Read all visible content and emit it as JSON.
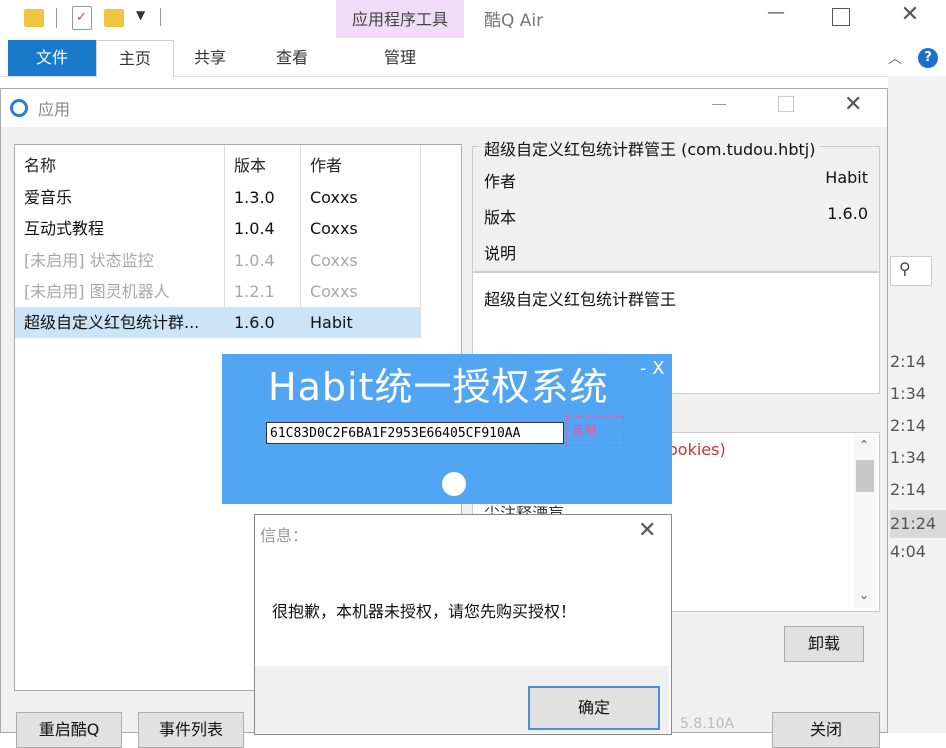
{
  "explorer": {
    "title": "酷Q Air",
    "contextual_tab": "应用程序工具",
    "tabs": [
      "文件",
      "主页",
      "共享",
      "查看",
      "管理"
    ],
    "help_glyph": "?",
    "times": [
      "2:14",
      "1:34",
      "2:14",
      "1:34",
      "2:14",
      "21:24",
      "4:04"
    ]
  },
  "dialog": {
    "title": "应用",
    "list": {
      "headers": [
        "名称",
        "版本",
        "作者"
      ],
      "rows": [
        {
          "name": "爱音乐",
          "version": "1.3.0",
          "author": "Coxxs",
          "state": "normal"
        },
        {
          "name": "互动式教程",
          "version": "1.0.4",
          "author": "Coxxs",
          "state": "normal"
        },
        {
          "name": "[未启用] 状态监控",
          "version": "1.0.4",
          "author": "Coxxs",
          "state": "disabled"
        },
        {
          "name": "[未启用] 图灵机器人",
          "version": "1.2.1",
          "author": "Coxxs",
          "state": "disabled"
        },
        {
          "name": "超级自定义红包统计群...",
          "version": "1.6.0",
          "author": "Habit",
          "state": "selected"
        }
      ]
    },
    "details": {
      "group_title": "超级自定义红包统计群管王 (com.tudou.hbtj)",
      "author_label": "作者",
      "author_value": "Habit",
      "version_label": "版本",
      "version_value": "1.6.0",
      "desc_label": "说明",
      "description": "超级自定义红包统计群管王"
    },
    "log_partial": "ookies)",
    "partial_under_overlay": "尘注释湮肓",
    "uninstall_button": "卸载",
    "bottom_buttons": [
      "重启酷Q",
      "事件列表",
      "关闭"
    ],
    "status_partial": "5.8.10A"
  },
  "habit_overlay": {
    "title": "Habit统一授权系统",
    "controls": "- X",
    "machine_code": "61C83D0C2F6BA1F2953E66405CF910AA",
    "aux_label": "复制"
  },
  "message_box": {
    "title": "信息：",
    "text": "很抱歉，本机器未授权，请您先购买授权！",
    "ok_button": "确定"
  }
}
